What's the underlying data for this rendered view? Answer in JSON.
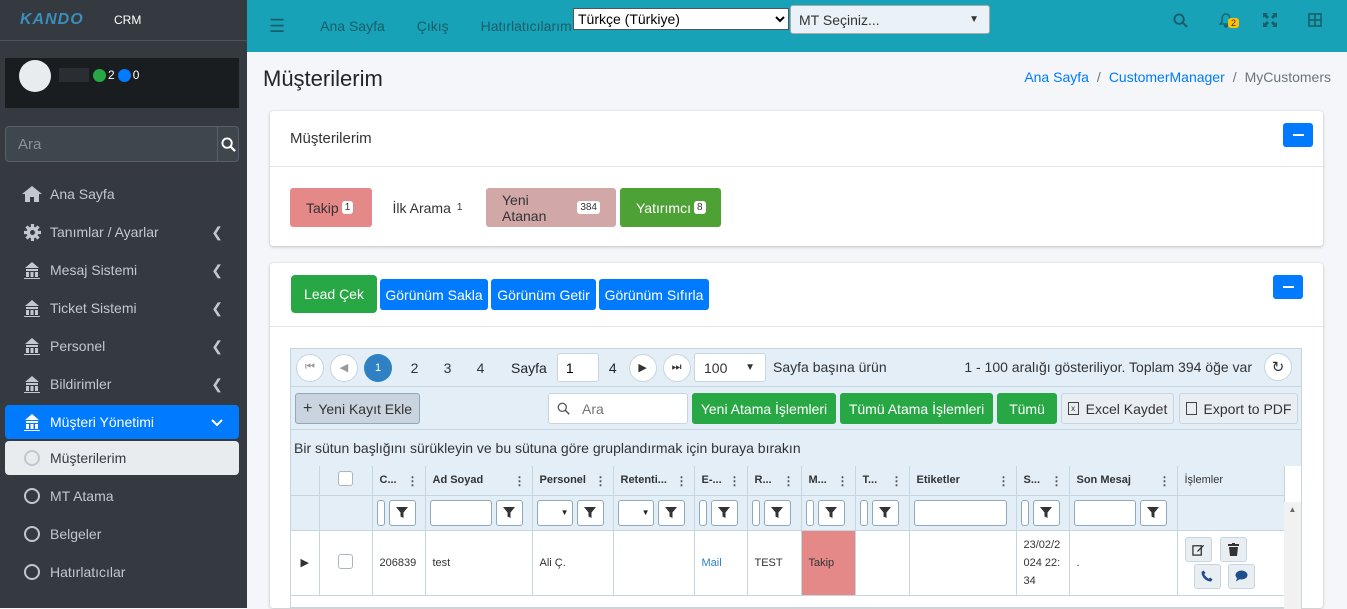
{
  "brand": {
    "logo_text": "KANDO",
    "app_name": "CRM"
  },
  "user": {
    "online_count": "2",
    "other_count": "0",
    "colors": {
      "online": "#28a745",
      "other": "#007bff"
    }
  },
  "sidebar": {
    "search_placeholder": "Ara",
    "items": [
      {
        "label": "Ana Sayfa",
        "icon": "home-icon"
      },
      {
        "label": "Tanımlar / Ayarlar",
        "icon": "gear-icon"
      },
      {
        "label": "Mesaj Sistemi",
        "icon": "building-icon"
      },
      {
        "label": "Ticket Sistemi",
        "icon": "building-icon"
      },
      {
        "label": "Personel",
        "icon": "building-icon"
      },
      {
        "label": "Bildirimler",
        "icon": "building-icon"
      },
      {
        "label": "Müşteri Yönetimi",
        "icon": "building-icon"
      },
      {
        "label": "Müşterilerim",
        "icon": "circle-icon"
      },
      {
        "label": "MT Atama",
        "icon": "circle-icon"
      },
      {
        "label": "Belgeler",
        "icon": "circle-icon"
      },
      {
        "label": "Hatırlatıcılar",
        "icon": "circle-icon"
      }
    ]
  },
  "topbar": {
    "links": [
      "Ana Sayfa",
      "Çıkış",
      "Hatırlatıcılarım"
    ],
    "language": "Türkçe (Türkiye)",
    "mt_select": "MT Seçiniz...",
    "notification_count": "2"
  },
  "page": {
    "title": "Müşterilerim",
    "breadcrumb": [
      "Ana Sayfa",
      "CustomerManager",
      "MyCustomers"
    ]
  },
  "status_card": {
    "title": "Müşterilerim",
    "tags": [
      {
        "label": "Takip",
        "count": "1",
        "bg": "#e48888",
        "fg": "#333333"
      },
      {
        "label": "İlk Arama",
        "count": "1",
        "bg": "#ffffff",
        "fg": "#333333"
      },
      {
        "label": "Yeni Atanan",
        "count": "384",
        "bg": "#d1a7a7",
        "fg": "#333333"
      },
      {
        "label": "Yatırımcı",
        "count": "8",
        "bg": "#4ea235",
        "fg": "#ffffff"
      }
    ]
  },
  "actions": {
    "lead": "Lead Çek",
    "save_view": "Görünüm Sakla",
    "load_view": "Görünüm Getir",
    "reset_view": "Görünüm Sıfırla"
  },
  "pager": {
    "pages": [
      "1",
      "2",
      "3",
      "4"
    ],
    "page_label": "Sayfa",
    "page_value": "1",
    "page_total": "4",
    "page_size": "100",
    "page_size_label": "Sayfa başına ürün",
    "info": "1 - 100 aralığı gösteriliyor. Toplam 394 öğe var"
  },
  "toolbar": {
    "add": "Yeni Kayıt Ekle",
    "search_placeholder": "Ara",
    "new_assign": "Yeni Atama İşlemleri",
    "all_assign": "Tümü Atama İşlemleri",
    "all": "Tümü",
    "excel": "Excel Kaydet",
    "pdf": "Export to PDF"
  },
  "group_hint": "Bir sütun başlığını sürükleyin ve bu sütuna göre gruplandırmak için buraya bırakın",
  "columns": [
    "C...",
    "Ad Soyad",
    "Personel",
    "Retenti...",
    "E-...",
    "R...",
    "M...",
    "T...",
    "Etiketler",
    "S...",
    "Son Mesaj",
    "İşlemler"
  ],
  "rows": [
    {
      "id": "206839",
      "name": "test",
      "personel": "Ali Ç.",
      "retention": "",
      "email": "Mail",
      "r": "TEST",
      "m": "Takip",
      "t": "",
      "tags": "",
      "date": "23/02/2024 22:34",
      "last_message": "."
    }
  ]
}
